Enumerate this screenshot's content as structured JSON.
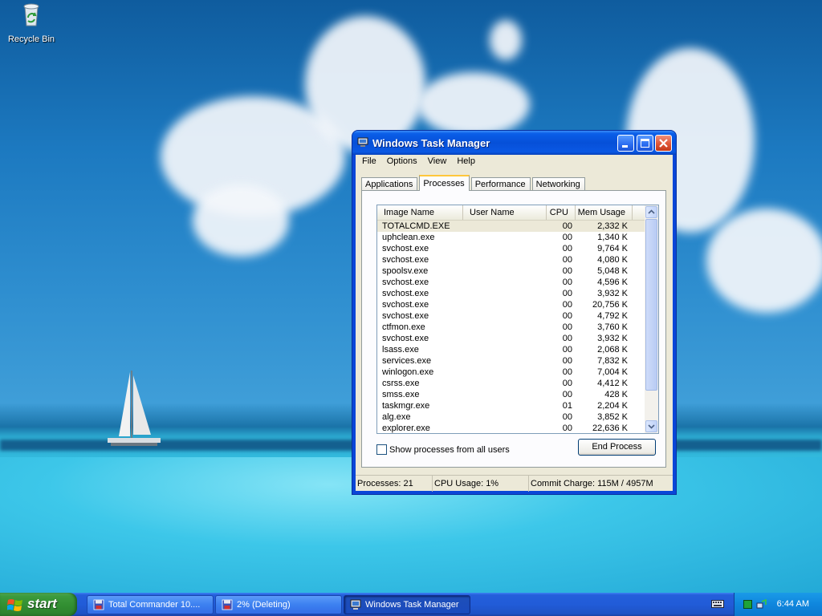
{
  "desktop": {
    "icons": [
      {
        "label": "Recycle Bin",
        "icon": "recycle-bin-icon"
      }
    ]
  },
  "window": {
    "title": "Windows Task Manager",
    "menu": [
      "File",
      "Options",
      "View",
      "Help"
    ],
    "tabs": [
      {
        "label": "Applications",
        "active": false
      },
      {
        "label": "Processes",
        "active": true
      },
      {
        "label": "Performance",
        "active": false
      },
      {
        "label": "Networking",
        "active": false
      }
    ],
    "columns": {
      "name": "Image Name",
      "user": "User Name",
      "cpu": "CPU",
      "mem": "Mem Usage"
    },
    "processes": [
      {
        "name": "TOTALCMD.EXE",
        "user": "",
        "cpu": "00",
        "mem": "2,332 K"
      },
      {
        "name": "uphclean.exe",
        "user": "",
        "cpu": "00",
        "mem": "1,340 K"
      },
      {
        "name": "svchost.exe",
        "user": "",
        "cpu": "00",
        "mem": "9,764 K"
      },
      {
        "name": "svchost.exe",
        "user": "",
        "cpu": "00",
        "mem": "4,080 K"
      },
      {
        "name": "spoolsv.exe",
        "user": "",
        "cpu": "00",
        "mem": "5,048 K"
      },
      {
        "name": "svchost.exe",
        "user": "",
        "cpu": "00",
        "mem": "4,596 K"
      },
      {
        "name": "svchost.exe",
        "user": "",
        "cpu": "00",
        "mem": "3,932 K"
      },
      {
        "name": "svchost.exe",
        "user": "",
        "cpu": "00",
        "mem": "20,756 K"
      },
      {
        "name": "svchost.exe",
        "user": "",
        "cpu": "00",
        "mem": "4,792 K"
      },
      {
        "name": "ctfmon.exe",
        "user": "",
        "cpu": "00",
        "mem": "3,760 K"
      },
      {
        "name": "svchost.exe",
        "user": "",
        "cpu": "00",
        "mem": "3,932 K"
      },
      {
        "name": "lsass.exe",
        "user": "",
        "cpu": "00",
        "mem": "2,068 K"
      },
      {
        "name": "services.exe",
        "user": "",
        "cpu": "00",
        "mem": "7,832 K"
      },
      {
        "name": "winlogon.exe",
        "user": "",
        "cpu": "00",
        "mem": "7,004 K"
      },
      {
        "name": "csrss.exe",
        "user": "",
        "cpu": "00",
        "mem": "4,412 K"
      },
      {
        "name": "smss.exe",
        "user": "",
        "cpu": "00",
        "mem": "428 K"
      },
      {
        "name": "taskmgr.exe",
        "user": "",
        "cpu": "01",
        "mem": "2,204 K"
      },
      {
        "name": "alg.exe",
        "user": "",
        "cpu": "00",
        "mem": "3,852 K"
      },
      {
        "name": "explorer.exe",
        "user": "",
        "cpu": "00",
        "mem": "22,636 K"
      }
    ],
    "selected_row": 0,
    "show_all_label": "Show processes from all users",
    "show_all_checked": false,
    "end_process_label": "End Process",
    "status": {
      "processes": "Processes: 21",
      "cpu": "CPU Usage: 1%",
      "commit": "Commit Charge: 115M / 4957M"
    }
  },
  "taskbar": {
    "start_label": "start",
    "tasks": [
      {
        "label": "Total Commander 10....",
        "icon": "floppy-disk-icon",
        "active": false
      },
      {
        "label": "2%  (Deleting)",
        "icon": "floppy-disk-icon",
        "active": false
      },
      {
        "label": "Windows Task Manager",
        "icon": "computer-monitor-icon",
        "active": true
      }
    ],
    "clock": "6:44 AM"
  },
  "colors": {
    "titlebar": "#0650d8",
    "window_face": "#ece9d8",
    "taskbar": "#245edb",
    "start_button": "#318d31",
    "tray": "#0f86dd"
  }
}
